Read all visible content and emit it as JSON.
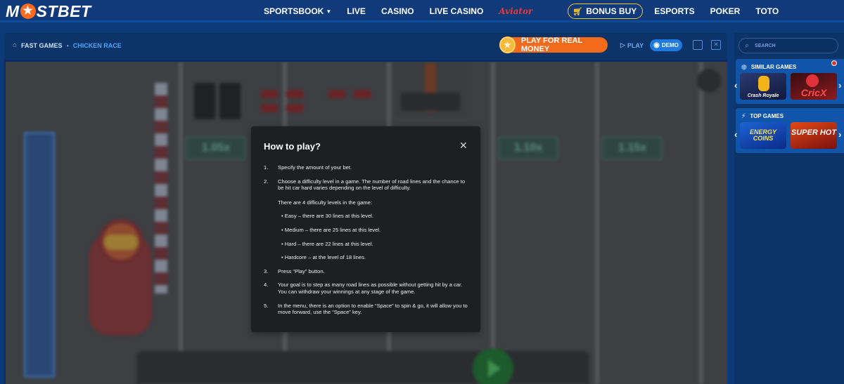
{
  "brand": {
    "logo_left": "M",
    "logo_right": "STBET",
    "star_glyph": "★",
    "accent": "#f26a1b"
  },
  "nav": {
    "items": [
      {
        "label": "SPORTSBOOK",
        "chevron": "⌄"
      },
      {
        "label": "LIVE"
      },
      {
        "label": "CASINO"
      },
      {
        "label": "LIVE CASINO"
      },
      {
        "label": "Aviator"
      },
      {
        "label": "BONUS BUY",
        "icon": "cart-icon"
      },
      {
        "label": "ESPORTS"
      },
      {
        "label": "POKER"
      },
      {
        "label": "TOTO"
      }
    ]
  },
  "game_header": {
    "breadcrumb": [
      "FAST GAMES",
      "CHICKEN RACE"
    ],
    "breadcrumb_separator": "•",
    "real_money_label": "PLAY FOR REAL MONEY",
    "play_label": "PLAY",
    "demo_label": "DEMO"
  },
  "game": {
    "multipliers": [
      "1.05x",
      "1.10x",
      "1.15x"
    ]
  },
  "modal": {
    "title": "How to play?",
    "close_glyph": "✕",
    "steps": [
      {
        "num": "1.",
        "text": "Specify the amount of your bet."
      },
      {
        "num": "2.",
        "text": "Choose a difficulty level in a game. The number of road lines and the chance to be hit car hard varies depending on the level of difficulty."
      },
      {
        "num": "3.",
        "text": "Press “Play” button."
      },
      {
        "num": "4.",
        "text": "Your goal is to step as many road lines as possible without getting hit by a car. You can withdraw your winnings at any stage of the game."
      },
      {
        "num": "5.",
        "text": "In the menu, there is an option to enable “Space” to spin & go, it will allow you to move forward, use the “Space” key."
      }
    ],
    "levels_intro": "There are 4 difficulty levels in the game:",
    "levels": [
      "• Easy – there are 30 lines at this level.",
      "• Medium – there are 25 lines at this level.",
      "• Hard – there are 22 lines at this level.",
      "• Hardcore – at the level of 18 lines."
    ]
  },
  "sidebar": {
    "search_placeholder": "SEARCH",
    "similar_title": "SIMILAR GAMES",
    "similar_games": [
      "Crash Royale",
      "CricX"
    ],
    "top_title": "TOP GAMES",
    "top_games": [
      "ENERGY COINS",
      "SUPER HOT"
    ]
  }
}
